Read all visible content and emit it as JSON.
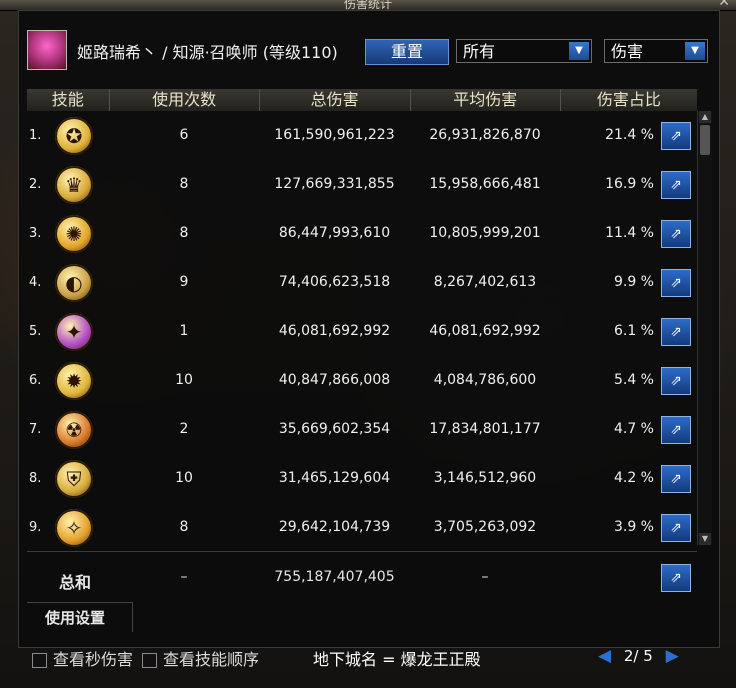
{
  "window": {
    "title": "伤害统计",
    "close_icon": "close-icon"
  },
  "header": {
    "character": "姬路瑞希丶 / 知源·召唤师 (等级110)",
    "reset_label": "重置",
    "scope_value": "所有",
    "metric_value": "伤害"
  },
  "table": {
    "columns": [
      "技能",
      "使用次数",
      "总伤害",
      "平均伤害",
      "伤害占比"
    ],
    "rows": [
      {
        "rank": "1.",
        "uses": "6",
        "total": "161,590,961,223",
        "avg": "26,931,826,870",
        "pct": "21.4 %",
        "color": "#e0b13a"
      },
      {
        "rank": "2.",
        "uses": "8",
        "total": "127,669,331,855",
        "avg": "15,958,666,481",
        "pct": "16.9 %",
        "color": "#d9a93a"
      },
      {
        "rank": "3.",
        "uses": "8",
        "total": "86,447,993,610",
        "avg": "10,805,999,201",
        "pct": "11.4 %",
        "color": "#e3a52a"
      },
      {
        "rank": "4.",
        "uses": "9",
        "total": "74,406,623,518",
        "avg": "8,267,402,613",
        "pct": "9.9 %",
        "color": "#caa045"
      },
      {
        "rank": "5.",
        "uses": "1",
        "total": "46,081,692,992",
        "avg": "46,081,692,992",
        "pct": "6.1 %",
        "color": "#b24cc7"
      },
      {
        "rank": "6.",
        "uses": "10",
        "total": "40,847,866,008",
        "avg": "4,084,786,600",
        "pct": "5.4 %",
        "color": "#e0b53e"
      },
      {
        "rank": "7.",
        "uses": "2",
        "total": "35,669,602,354",
        "avg": "17,834,801,177",
        "pct": "4.7 %",
        "color": "#d9782a"
      },
      {
        "rank": "8.",
        "uses": "10",
        "total": "31,465,129,604",
        "avg": "3,146,512,960",
        "pct": "4.2 %",
        "color": "#d7ab3b"
      },
      {
        "rank": "9.",
        "uses": "8",
        "total": "29,642,104,739",
        "avg": "3,705,263,092",
        "pct": "3.9 %",
        "color": "#e4a02c"
      }
    ],
    "summary": {
      "label": "总和",
      "uses": "–",
      "total": "755,187,407,405",
      "avg": "–"
    }
  },
  "settings_tab": "使用设置",
  "bottom": {
    "check_per_second": "查看秒伤害",
    "check_skill_order": "查看技能顺序",
    "dungeon": "地下城名 = 爆龙王正殿",
    "page": "2/ 5"
  }
}
